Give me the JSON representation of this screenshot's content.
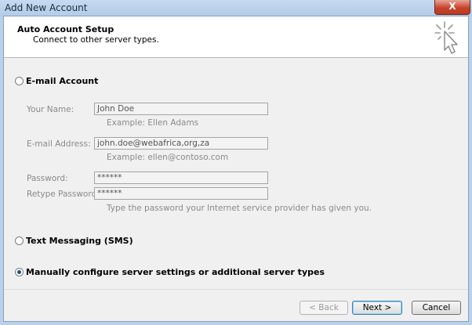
{
  "window": {
    "title": "Add New Account",
    "close_label": "X"
  },
  "header": {
    "title": "Auto Account Setup",
    "subtitle": "Connect to other server types."
  },
  "options": {
    "email_account": {
      "label": "E-mail Account",
      "selected": false
    },
    "text_messaging": {
      "label": "Text Messaging (SMS)",
      "selected": false
    },
    "manual": {
      "label": "Manually configure server settings or additional server types",
      "selected": true
    }
  },
  "form": {
    "your_name": {
      "label": "Your Name:",
      "value": "John Doe",
      "hint": "Example: Ellen Adams"
    },
    "email_address": {
      "label": "E-mail Address:",
      "value": "john.doe@webafrica,org,za",
      "hint": "Example: ellen@contoso.com"
    },
    "password": {
      "label": "Password:",
      "value": "******"
    },
    "retype_password": {
      "label": "Retype Password:",
      "value": "******",
      "hint": "Type the password your Internet service provider has given you."
    }
  },
  "buttons": {
    "back": "< Back",
    "next": "Next >",
    "cancel": "Cancel"
  },
  "icons": {
    "wizard": "wizard-cursor-icon"
  }
}
